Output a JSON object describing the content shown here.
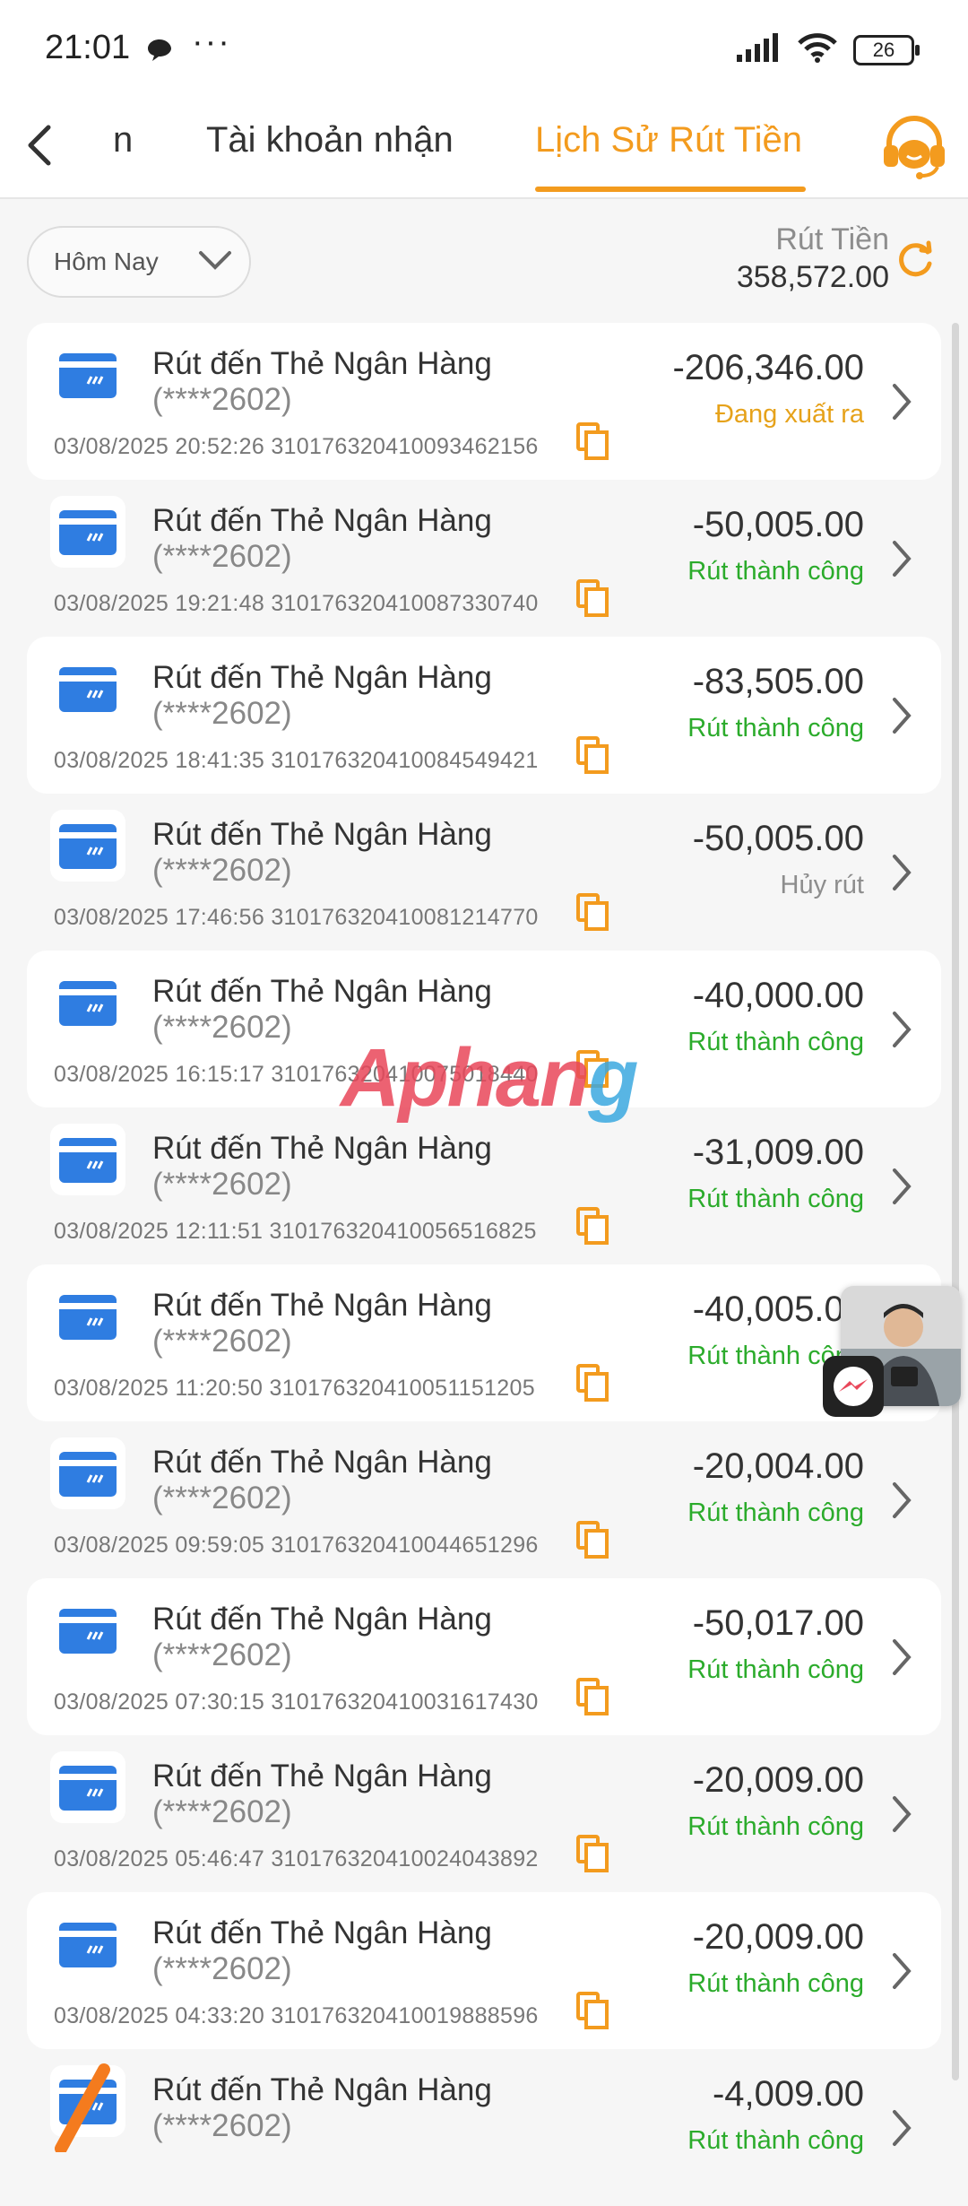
{
  "status_bar": {
    "time": "21:01",
    "dots": "···",
    "battery": "26"
  },
  "header": {
    "back_label": "<",
    "tab_partial": "n",
    "tab_receive": "Tài khoản nhận",
    "tab_history": "Lịch Sử Rút Tiền",
    "accent": "#f39b1e"
  },
  "filter": {
    "label": "Hôm Nay"
  },
  "summary": {
    "title": "Rút Tiền",
    "amount": "358,572.00"
  },
  "status_colors": {
    "processing": "#e6a21a",
    "success": "#2bab2b",
    "cancelled": "#8d8d8d"
  },
  "transactions": [
    {
      "title": "Rút đến Thẻ Ngân Hàng",
      "account": "(****2602)",
      "datetime": "03/08/2025 20:52:26",
      "code": "310176320410093462156",
      "amount": "-206,346.00",
      "status": "Đang xuất ra"
    },
    {
      "title": "Rút đến Thẻ Ngân Hàng",
      "account": "(****2602)",
      "datetime": "03/08/2025 19:21:48",
      "code": "310176320410087330740",
      "amount": "-50,005.00",
      "status": "Rút thành công"
    },
    {
      "title": "Rút đến Thẻ Ngân Hàng",
      "account": "(****2602)",
      "datetime": "03/08/2025 18:41:35",
      "code": "310176320410084549421",
      "amount": "-83,505.00",
      "status": "Rút thành công"
    },
    {
      "title": "Rút đến Thẻ Ngân Hàng",
      "account": "(****2602)",
      "datetime": "03/08/2025 17:46:56",
      "code": "310176320410081214770",
      "amount": "-50,005.00",
      "status": "Hủy rút"
    },
    {
      "title": "Rút đến Thẻ Ngân Hàng",
      "account": "(****2602)",
      "datetime": "03/08/2025 16:15:17",
      "code": "310176320410075018440",
      "amount": "-40,000.00",
      "status": "Rút thành công"
    },
    {
      "title": "Rút đến Thẻ Ngân Hàng",
      "account": "(****2602)",
      "datetime": "03/08/2025 12:11:51",
      "code": "310176320410056516825",
      "amount": "-31,009.00",
      "status": "Rút thành công"
    },
    {
      "title": "Rút đến Thẻ Ngân Hàng",
      "account": "(****2602)",
      "datetime": "03/08/2025 11:20:50",
      "code": "310176320410051151205",
      "amount": "-40,005.00",
      "status": "Rút thành công"
    },
    {
      "title": "Rút đến Thẻ Ngân Hàng",
      "account": "(****2602)",
      "datetime": "03/08/2025 09:59:05",
      "code": "310176320410044651296",
      "amount": "-20,004.00",
      "status": "Rút thành công"
    },
    {
      "title": "Rút đến Thẻ Ngân Hàng",
      "account": "(****2602)",
      "datetime": "03/08/2025 07:30:15",
      "code": "310176320410031617430",
      "amount": "-50,017.00",
      "status": "Rút thành công"
    },
    {
      "title": "Rút đến Thẻ Ngân Hàng",
      "account": "(****2602)",
      "datetime": "03/08/2025 05:46:47",
      "code": "310176320410024043892",
      "amount": "-20,009.00",
      "status": "Rút thành công"
    },
    {
      "title": "Rút đến Thẻ Ngân Hàng",
      "account": "(****2602)",
      "datetime": "03/08/2025 04:33:20",
      "code": "310176320410019888596",
      "amount": "-20,009.00",
      "status": "Rút thành công"
    },
    {
      "title": "Rút đến Thẻ Ngân Hàng",
      "account": "(****2602)",
      "amount": "-4,009.00",
      "status": "Rút thành công"
    }
  ],
  "watermark": {
    "part1": "Aphan",
    "part2": "g"
  }
}
